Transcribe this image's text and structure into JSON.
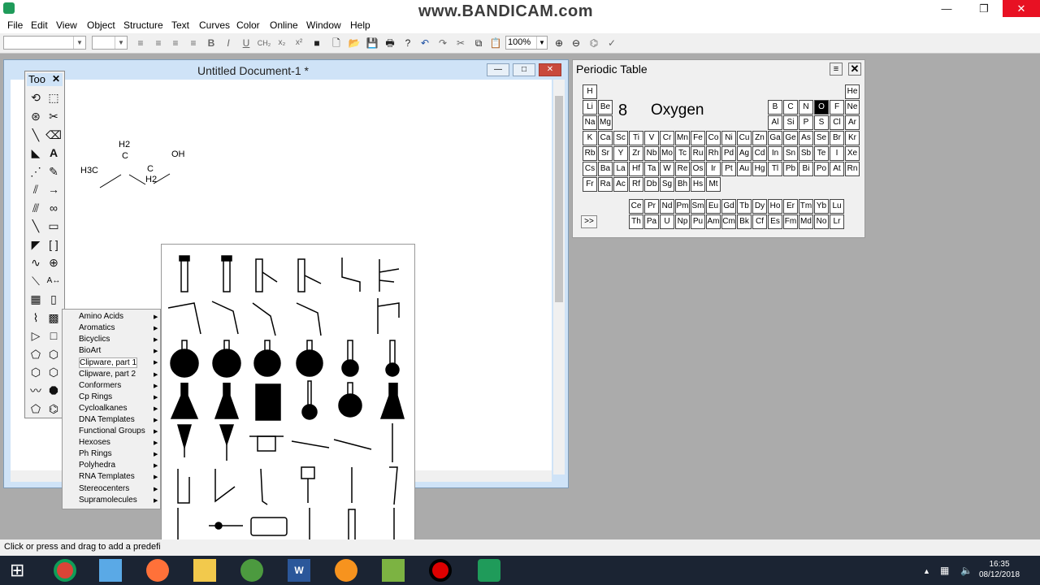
{
  "app": {
    "watermark": "www.BANDICAM.com"
  },
  "window_controls": {
    "minimize": "—",
    "restore": "❐",
    "close": "✕"
  },
  "menu": [
    "File",
    "Edit",
    "View",
    "Object",
    "Structure",
    "Text",
    "Curves",
    "Color",
    "Online",
    "Window",
    "Help"
  ],
  "toolbar": {
    "zoom": "100%"
  },
  "tools_palette": {
    "title": "Too"
  },
  "document": {
    "title": "Untitled Document-1 *"
  },
  "molecule": {
    "h2_top": "H2",
    "c1": "C",
    "oh": "OH",
    "h3c": "H3C",
    "c2": "C",
    "h2_bottom": "H2"
  },
  "periodic_table": {
    "title": "Periodic Table",
    "selected_number": "8",
    "selected_name": "Oxygen",
    "more_button": ">>",
    "rows": [
      [
        "H",
        "He"
      ],
      [
        "Li",
        "Be",
        "B",
        "C",
        "N",
        "O",
        "F",
        "Ne"
      ],
      [
        "Na",
        "Mg",
        "Al",
        "Si",
        "P",
        "S",
        "Cl",
        "Ar"
      ],
      [
        "K",
        "Ca",
        "Sc",
        "Ti",
        "V",
        "Cr",
        "Mn",
        "Fe",
        "Co",
        "Ni",
        "Cu",
        "Zn",
        "Ga",
        "Ge",
        "As",
        "Se",
        "Br",
        "Kr"
      ],
      [
        "Rb",
        "Sr",
        "Y",
        "Zr",
        "Nb",
        "Mo",
        "Tc",
        "Ru",
        "Rh",
        "Pd",
        "Ag",
        "Cd",
        "In",
        "Sn",
        "Sb",
        "Te",
        "I",
        "Xe"
      ],
      [
        "Cs",
        "Ba",
        "La",
        "Hf",
        "Ta",
        "W",
        "Re",
        "Os",
        "Ir",
        "Pt",
        "Au",
        "Hg",
        "Tl",
        "Pb",
        "Bi",
        "Po",
        "At",
        "Rn"
      ],
      [
        "Fr",
        "Ra",
        "Ac",
        "Rf",
        "Db",
        "Sg",
        "Bh",
        "Hs",
        "Mt"
      ]
    ],
    "lanthanides": [
      "Ce",
      "Pr",
      "Nd",
      "Pm",
      "Sm",
      "Eu",
      "Gd",
      "Tb",
      "Dy",
      "Ho",
      "Er",
      "Tm",
      "Yb",
      "Lu"
    ],
    "actinides": [
      "Th",
      "Pa",
      "U",
      "Np",
      "Pu",
      "Am",
      "Cm",
      "Bk",
      "Cf",
      "Es",
      "Fm",
      "Md",
      "No",
      "Lr"
    ],
    "selected_symbol": "O"
  },
  "templates_menu": {
    "items": [
      "Amino Acids",
      "Aromatics",
      "Bicyclics",
      "BioArt",
      "Clipware, part 1",
      "Clipware, part 2",
      "Conformers",
      "Cp Rings",
      "Cycloalkanes",
      "DNA Templates",
      "Functional Groups",
      "Hexoses",
      "Ph Rings",
      "Polyhedra",
      "RNA Templates",
      "Stereocenters",
      "Supramolecules"
    ],
    "highlighted": "Clipware, part 1"
  },
  "status": {
    "text": "Click or press and drag to add a predefi"
  },
  "taskbar": {
    "time": "16:35",
    "date": "08/12/2018"
  }
}
